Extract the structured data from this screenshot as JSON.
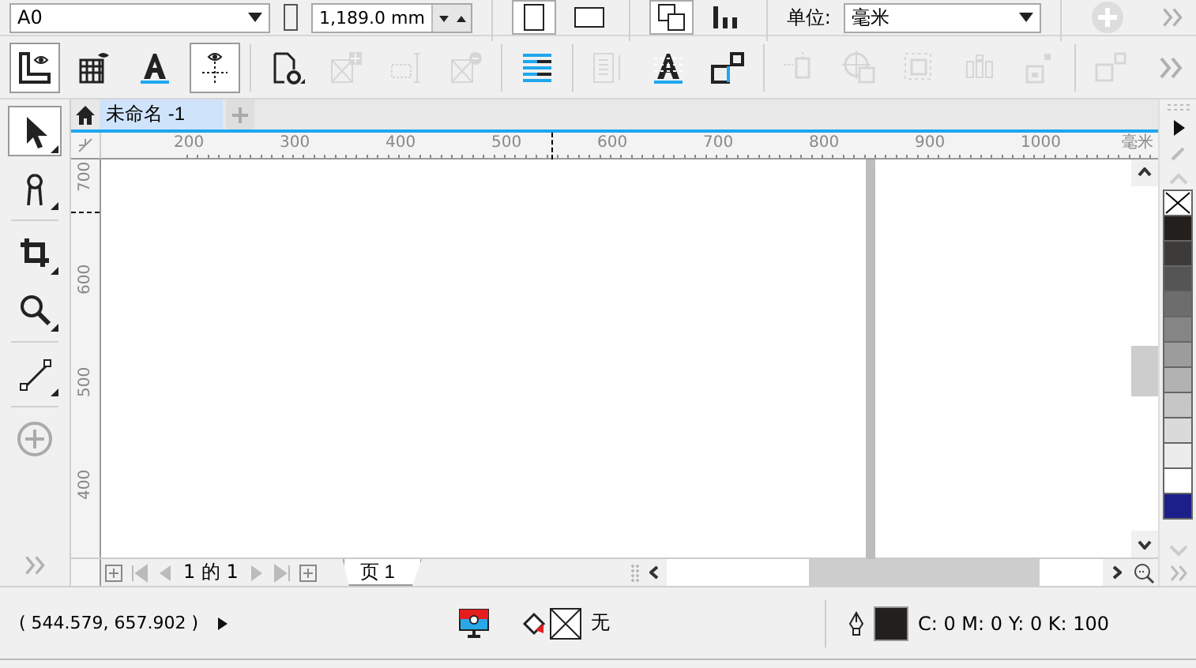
{
  "property_bar": {
    "paper_size": "A0",
    "height_field": "1,189.0 mm",
    "units_label": "单位:",
    "units_value": "毫米"
  },
  "toolbar": {
    "groups": [
      [
        {
          "pressed": true,
          "disabled": false
        },
        {
          "pressed": false,
          "disabled": false
        },
        {
          "pressed": false,
          "disabled": false
        },
        {
          "pressed": true,
          "disabled": false
        }
      ],
      [
        {
          "pressed": false,
          "disabled": false
        },
        {
          "pressed": false,
          "disabled": true
        },
        {
          "pressed": false,
          "disabled": true
        },
        {
          "pressed": false,
          "disabled": true
        }
      ],
      [
        {
          "pressed": false,
          "disabled": false
        }
      ],
      [
        {
          "pressed": false,
          "disabled": true
        },
        {
          "pressed": false,
          "disabled": false
        },
        {
          "pressed": false,
          "disabled": false
        }
      ],
      [
        {
          "pressed": false,
          "disabled": true
        },
        {
          "pressed": false,
          "disabled": true
        },
        {
          "pressed": false,
          "disabled": true
        },
        {
          "pressed": false,
          "disabled": true
        },
        {
          "pressed": false,
          "disabled": true
        }
      ],
      [
        {
          "pressed": false,
          "disabled": true
        }
      ]
    ]
  },
  "toolbox": {
    "tools": [
      {
        "selected": true,
        "flyout": true
      },
      {
        "selected": false,
        "flyout": true
      },
      {
        "selected": false,
        "flyout": true
      },
      {
        "selected": false,
        "flyout": true
      },
      {
        "selected": false,
        "flyout": true
      },
      {
        "selected": false,
        "flyout": false
      }
    ]
  },
  "document_tabs": [
    {
      "label": "未命名 -1",
      "selected": true
    }
  ],
  "top_ruler": {
    "labels": [
      "200",
      "300",
      "400",
      "500",
      "600",
      "700",
      "800",
      "900",
      "1000"
    ],
    "unit": "毫米"
  },
  "left_ruler": {
    "labels": [
      "700",
      "600",
      "500",
      "400"
    ]
  },
  "page_navigator": {
    "counter": "1 的 1",
    "pages": [
      {
        "label": "页 1",
        "selected": true
      }
    ]
  },
  "palette": {
    "swatches": [
      {
        "kind": "none"
      },
      {
        "kind": "color",
        "color": "#231f1c"
      },
      {
        "kind": "color",
        "color": "#3d3a3a"
      },
      {
        "kind": "color",
        "color": "#555555"
      },
      {
        "kind": "color",
        "color": "#6d6d6d"
      },
      {
        "kind": "color",
        "color": "#858585"
      },
      {
        "kind": "color",
        "color": "#9c9c9c"
      },
      {
        "kind": "color",
        "color": "#b2b2b2"
      },
      {
        "kind": "color",
        "color": "#c6c6c6"
      },
      {
        "kind": "color",
        "color": "#dadada"
      },
      {
        "kind": "color",
        "color": "#ececec"
      },
      {
        "kind": "color",
        "color": "#ffffff"
      },
      {
        "kind": "color",
        "color": "#1c1f8a"
      }
    ]
  },
  "status_bar": {
    "coordinates": "( 544.579, 657.902 )",
    "fill_label": "无",
    "outline_swatch": {
      "color": "#231f1c"
    },
    "outline_values": "C: 0 M: 0 Y: 0 K: 100"
  }
}
